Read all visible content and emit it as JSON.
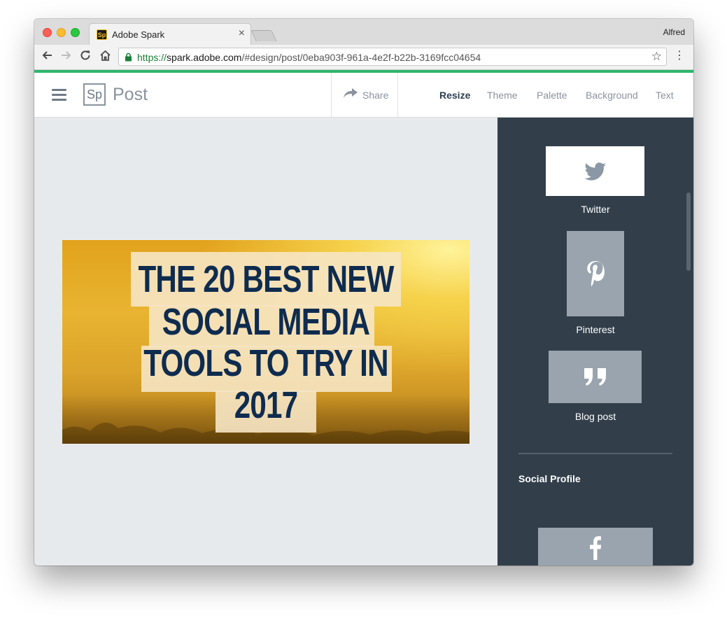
{
  "browser": {
    "tab_title": "Adobe Spark",
    "tab_favicon": "Sp",
    "tab_close": "×",
    "profile_name": "Alfred",
    "url_scheme": "https://",
    "url_host": "spark.adobe.com",
    "url_path": "/#design/post/0eba903f-961a-4e2f-b22b-3169fcc04654",
    "icons": [
      "back-icon",
      "forward-icon",
      "reload-icon",
      "home-icon",
      "lock-icon",
      "star-icon",
      "menu-icon"
    ]
  },
  "header": {
    "logo": "Sp",
    "app_name": "Post",
    "share_label": "Share",
    "menu": [
      "Resize",
      "Theme",
      "Palette",
      "Background",
      "Text"
    ],
    "active_menu": "Resize"
  },
  "post": {
    "headline": [
      "THE 20 BEST NEW",
      "SOCIAL MEDIA",
      "TOOLS TO TRY IN",
      "2017"
    ]
  },
  "sidebar": {
    "options": [
      {
        "label": "Twitter",
        "icon": "twitter-icon",
        "selected": true
      },
      {
        "label": "Pinterest",
        "icon": "pinterest-icon",
        "selected": false
      },
      {
        "label": "Blog post",
        "icon": "quote-icon",
        "selected": false
      }
    ],
    "section_title": "Social Profile",
    "partial_option_icon": "facebook-icon"
  },
  "colors": {
    "accent_green": "#2eb66b",
    "sidebar_bg": "#323f4b",
    "headline_text": "#0f2c4f",
    "active_menu": "#2c3e50"
  }
}
